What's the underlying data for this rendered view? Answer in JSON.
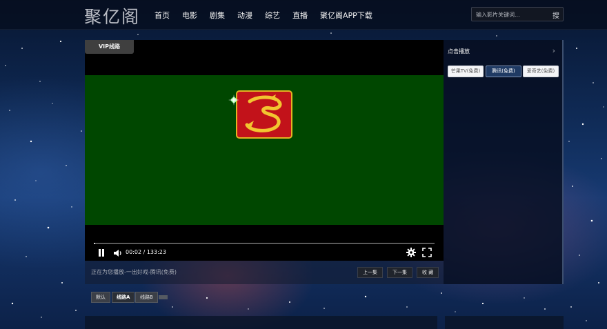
{
  "header": {
    "logo": "聚亿阁",
    "nav": [
      "首页",
      "电影",
      "剧集",
      "动漫",
      "综艺",
      "直播",
      "聚亿阁APP下载"
    ],
    "search_placeholder": "输入影片关键词...",
    "search_button": "搜"
  },
  "player": {
    "tab_label": "VIP线路",
    "time": "00:02 / 133:23",
    "progress": 0.00025,
    "video_background": "#004700"
  },
  "side": {
    "title": "点击播放",
    "arrow": "›",
    "sources": [
      "芒果TV(免费)",
      "腾讯(免费)",
      "爱奇艺(免费)"
    ],
    "active_source_index": 1
  },
  "caption": {
    "text": "正在为您播放-一出好戏-腾讯(免费)",
    "actions": [
      "上一集",
      "下一集",
      "收 藏"
    ]
  },
  "routes": [
    "默认",
    "线路A",
    "线路B"
  ],
  "active_route_index": 1,
  "icons": {
    "play_pause": "pause-icon",
    "volume": "volume-icon",
    "settings": "gear-icon",
    "fullscreen": "fullscreen-icon",
    "channel_logo": "dragon-logo"
  },
  "colors": {
    "accent_active": "#1f3a63",
    "video_green": "#004700",
    "logo_red": "#c2121a",
    "logo_gold": "#e3b322"
  }
}
